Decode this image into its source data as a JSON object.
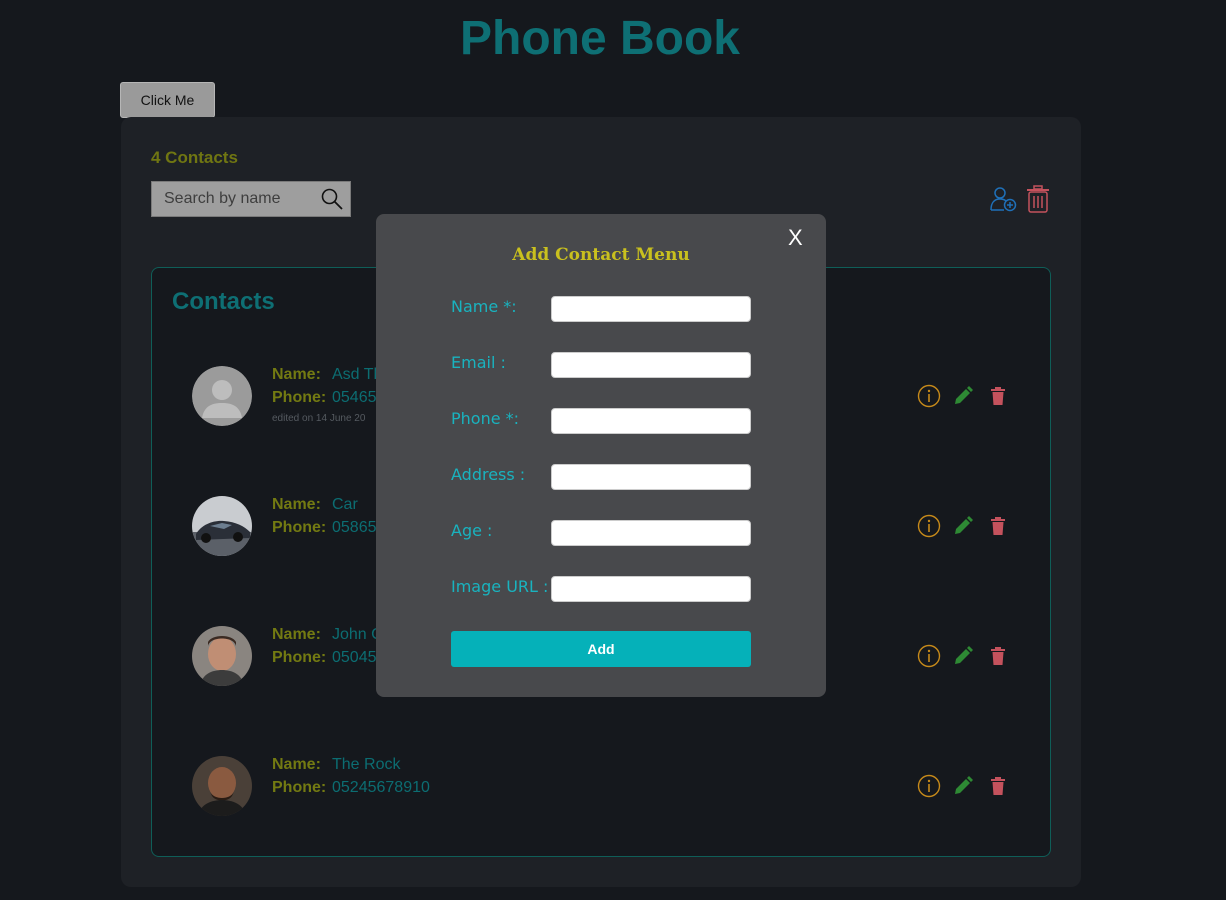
{
  "app": {
    "title": "Phone Book",
    "click_button_label": "Click Me"
  },
  "toolbar": {
    "contact_count": "4 Contacts",
    "search_placeholder": "Search by name",
    "search_value": ""
  },
  "contacts_section": {
    "heading": "Contacts",
    "name_label": "Name:",
    "phone_label": "Phone:",
    "items": [
      {
        "name": "Asd Th",
        "phone": "05465",
        "edited": "edited on 14 June 20",
        "avatar": "default-avatar"
      },
      {
        "name": "Car",
        "phone": "05865",
        "edited": "",
        "avatar": "car-photo"
      },
      {
        "name": "John C",
        "phone": "05045",
        "edited": "",
        "avatar": "person-photo"
      },
      {
        "name": "The Rock",
        "phone": "05245678910",
        "edited": "",
        "avatar": "person-photo"
      }
    ],
    "row_icons": [
      "info-icon",
      "edit-pencil-icon",
      "trash-icon"
    ]
  },
  "modal": {
    "title": "Add Contact Menu",
    "close_label": "X",
    "fields": [
      {
        "label": "Name *:",
        "value": ""
      },
      {
        "label": "Email :",
        "value": ""
      },
      {
        "label": "Phone *:",
        "value": ""
      },
      {
        "label": "Address :",
        "value": ""
      },
      {
        "label": "Age :",
        "value": ""
      },
      {
        "label": "Image URL :",
        "value": ""
      }
    ],
    "submit_label": "Add"
  },
  "colors": {
    "background": "#15181d",
    "title_teal": "#0e6f74",
    "label_olive": "#737a12",
    "modal_bg": "#48494c",
    "modal_title": "#c9c01e",
    "field_label": "#19b3bf",
    "add_button": "#05b1b9",
    "info_icon": "#c78a1a",
    "edit_icon": "#2e8a34",
    "delete_icon": "#c4525d",
    "add_user_icon": "#1f70b8"
  }
}
